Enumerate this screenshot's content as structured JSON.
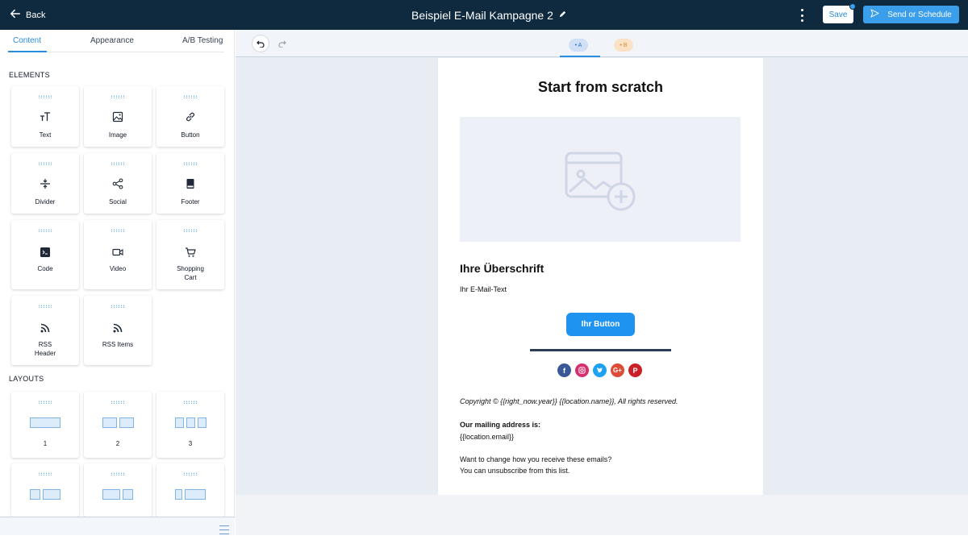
{
  "header": {
    "back_label": "Back",
    "campaign_title": "Beispiel E-Mail Kampagne 2",
    "save_label": "Save",
    "send_label": "Send or Schedule"
  },
  "sidebar": {
    "tabs": [
      {
        "label": "Content",
        "active": true
      },
      {
        "label": "Appearance",
        "active": false
      },
      {
        "label": "A/B Testing",
        "active": false
      }
    ],
    "elements_heading": "ELEMENTS",
    "elements": [
      {
        "label": "Text",
        "icon": "text-size-icon"
      },
      {
        "label": "Image",
        "icon": "image-icon"
      },
      {
        "label": "Button",
        "icon": "link-icon"
      },
      {
        "label": "Divider",
        "icon": "divider-icon"
      },
      {
        "label": "Social",
        "icon": "share-icon"
      },
      {
        "label": "Footer",
        "icon": "footer-icon"
      },
      {
        "label": "Code",
        "icon": "terminal-icon"
      },
      {
        "label": "Video",
        "icon": "video-icon"
      },
      {
        "label": "Shopping\nCart",
        "icon": "cart-icon"
      },
      {
        "label": "RSS\nHeader",
        "icon": "rss-icon"
      },
      {
        "label": "RSS Items",
        "icon": "rss-icon"
      }
    ],
    "layouts_heading": "LAYOUTS",
    "layouts": [
      {
        "label": "1"
      },
      {
        "label": "2"
      },
      {
        "label": "3"
      }
    ]
  },
  "canvas": {
    "variant_a": "• A",
    "variant_b": "• B",
    "active_variant": "A"
  },
  "email": {
    "title": "Start from scratch",
    "heading": "Ihre Überschrift",
    "body_text": "Ihr E-Mail-Text",
    "button_label": "Ihr Button",
    "social_icons": [
      "facebook-icon",
      "instagram-icon",
      "twitter-icon",
      "google-plus-icon",
      "pinterest-icon"
    ],
    "copyright": "Copyright © {{right_now.year}}  {{location.name}}, All rights reserved.",
    "mailing_label": "Our mailing address is:",
    "mailing_value": "{{location.email}}",
    "change_line1": "Want to change how you receive these emails?",
    "change_line2": "You can unsubscribe from this list."
  },
  "colors": {
    "topbar": "#0f2a3f",
    "accent": "#2a8de0",
    "cta": "#1f93f0"
  }
}
